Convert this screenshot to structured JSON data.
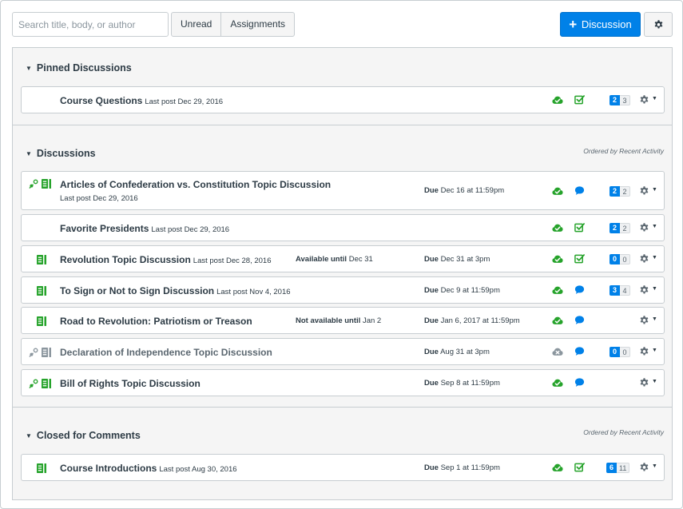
{
  "toolbar": {
    "search_placeholder": "Search title, body, or author",
    "unread_label": "Unread",
    "assignments_label": "Assignments",
    "add_discussion_label": "Discussion",
    "add_icon": "plus-icon",
    "settings_icon": "gear-icon"
  },
  "colors": {
    "primary": "#0081e8",
    "published_green": "#26a32b",
    "muted_gray": "#8b969e",
    "text": "#2d3b45",
    "assignment_green": "#26a32b"
  },
  "pinned": {
    "heading": "Pinned Discussions",
    "rows": [
      {
        "title": "Course Questions",
        "last_post": "Last post Dec 29, 2016",
        "unread": "2",
        "total": "3",
        "subscription": "checked-box"
      }
    ]
  },
  "discussions": {
    "heading": "Discussions",
    "sort_note": "Ordered by Recent Activity",
    "rows": [
      {
        "title": "Articles of Confederation vs. Constitution Topic Discussion",
        "last_post": "Last post Dec 29, 2016",
        "due_label": "Due",
        "due_date": "Dec 16 at 11:59pm",
        "unread": "2",
        "total": "2"
      },
      {
        "title": "Favorite Presidents",
        "last_post": "Last post Dec 29, 2016",
        "unread": "2",
        "total": "2"
      },
      {
        "title": "Revolution Topic Discussion",
        "last_post": "Last post Dec 28, 2016",
        "avail_label": "Available until",
        "avail_date": "Dec 31",
        "due_label": "Due",
        "due_date": "Dec 31 at 3pm",
        "unread": "0",
        "total": "0"
      },
      {
        "title": "To Sign or Not to Sign Discussion",
        "last_post": "Last post Nov 4, 2016",
        "due_label": "Due",
        "due_date": "Dec 9 at 11:59pm",
        "unread": "3",
        "total": "4"
      },
      {
        "title": "Road to Revolution: Patriotism or Treason",
        "avail_label": "Not available until",
        "avail_date": "Jan 2",
        "due_label": "Due",
        "due_date": "Jan 6, 2017 at 11:59pm"
      },
      {
        "title": "Declaration of Independence Topic Discussion",
        "due_label": "Due",
        "due_date": "Aug 31 at 3pm",
        "unread": "0",
        "total": "0"
      },
      {
        "title": "Bill of Rights Topic Discussion",
        "due_label": "Due",
        "due_date": "Sep 8 at 11:59pm"
      }
    ]
  },
  "closed": {
    "heading": "Closed for Comments",
    "sort_note": "Ordered by Recent Activity",
    "rows": [
      {
        "title": "Course Introductions",
        "last_post": "Last post Aug 30, 2016",
        "due_label": "Due",
        "due_date": "Sep 1 at 11:59pm",
        "unread": "6",
        "total": "11"
      }
    ]
  }
}
